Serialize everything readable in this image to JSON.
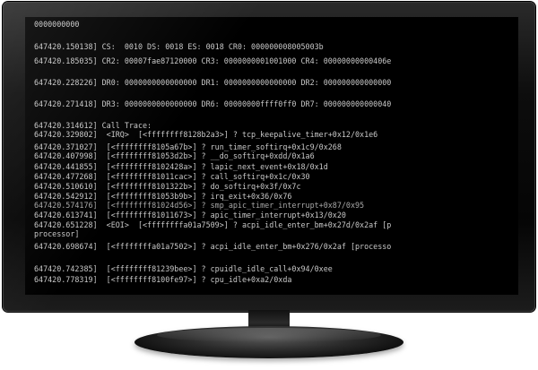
{
  "monitor": {
    "screen_lines": [
      {
        "text": "0000000000",
        "style": "normal"
      },
      {
        "text": "647420.150138] CS:  0010 DS: 0018 ES: 0018 CR0: 000000008005003b",
        "style": "normal"
      },
      {
        "text": "647420.185035] CR2: 00007fae87120000 CR3: 0000000001001000 CR4: 00000000000406e",
        "style": "normal"
      },
      {
        "text": "647420.228226] DR0: 0000000000000000 DR1: 0000000000000000 DR2: 000000000000000",
        "style": "normal"
      },
      {
        "text": "647420.271418] DR3: 0000000000000000 DR6: 00000000ffff0ff0 DR7: 000000000000040",
        "style": "normal"
      },
      {
        "text": "647420.314612] Call Trace:",
        "style": "normal"
      },
      {
        "text": "647420.329802]  <IRQ>  [<ffffffff8128b2a3>] ? tcp_keepalive_timer+0x12/0x1e6",
        "style": "normal"
      },
      {
        "text": "647420.371027]  [<ffffffff8105a67b>] ? run_timer_softirq+0x1c9/0x268",
        "style": "normal"
      },
      {
        "text": "647420.407998]  [<ffffffff81053d2b>] ? __do_softirq+0xdd/0x1a6",
        "style": "normal"
      },
      {
        "text": "647420.441855]  [<ffffffff8102428a>] ? lapic_next_event+0x18/0x1d",
        "style": "normal"
      },
      {
        "text": "647420.477268]  [<ffffffff81011cac>] ? call_softirq+0x1c/0x30",
        "style": "normal"
      },
      {
        "text": "647420.510610]  [<ffffffff8101322b>] ? do_softirq+0x3f/0x7c",
        "style": "normal"
      },
      {
        "text": "647420.542912]  [<ffffffff81053b9b>] ? irq_exit+0x36/0x76",
        "style": "normal"
      },
      {
        "text": "647420.574176]  [<ffffffff81024d56>] ? smp_apic_timer_interrupt+0x87/0x95",
        "style": "overstrike"
      },
      {
        "text": "647420.613741]  [<ffffffff81011673>] ? apic_timer_interrupt+0x13/0x20",
        "style": "normal"
      },
      {
        "text": "647420.651228]  <EOI>  [<ffffffffa01a7509>] ? acpi_idle_enter_bm+0x27d/0x2af [p",
        "style": "normal"
      },
      {
        "text": "processor]",
        "style": "normal"
      },
      {
        "text": "647420.698674]  [<ffffffffa01a7502>] ? acpi_idle_enter_bm+0x276/0x2af [processo",
        "style": "normal"
      },
      {
        "text": "647420.742385]  [<ffffffff81239bee>] ? cpuidle_idle_call+0x94/0xee",
        "style": "normal"
      },
      {
        "text": "647420.778319]  [<ffffffff8100fe97>] ? cpu_idle+0xa2/0xda",
        "style": "normal"
      }
    ]
  }
}
